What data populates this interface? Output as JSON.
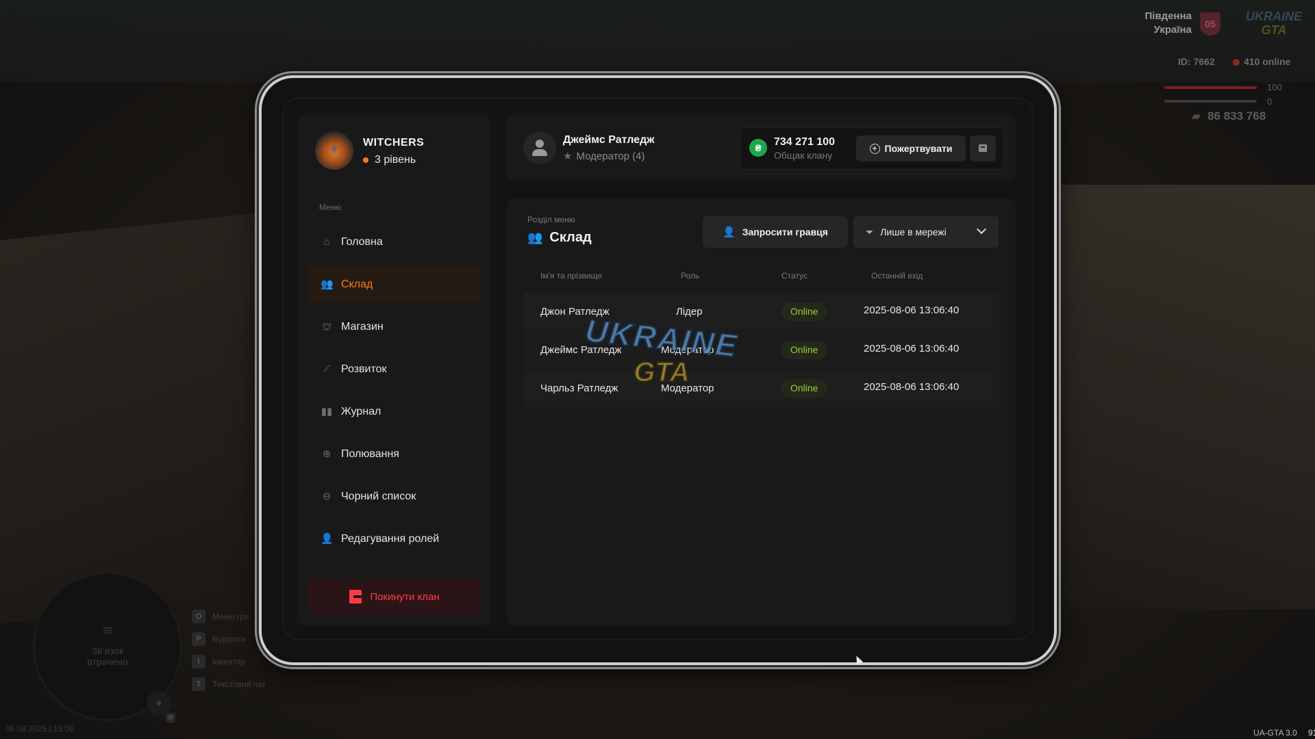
{
  "hud": {
    "region_line1": "Південна",
    "region_line2": "Україна",
    "region_badge": "05",
    "logo_top": "UKRAINE",
    "logo_bottom": "GTA",
    "player_id": "ID: 7662",
    "online": "410 online",
    "health": "100",
    "armor": "0",
    "money": "86 833 768",
    "minimap_text_line1": "Зв'язок",
    "minimap_text_line2": "втрачено",
    "mic_key": "Я",
    "hints": [
      {
        "key": "O",
        "label": "Меню гри"
      },
      {
        "key": "P",
        "label": "Відкрити"
      },
      {
        "key": "I",
        "label": "Інвентар"
      },
      {
        "key": "T",
        "label": "Текстовий чат"
      }
    ],
    "datetime": "06.08.2025 | 13:06",
    "version": "UA-GTA 3.0",
    "version_extra": "91"
  },
  "clan": {
    "name": "WITCHERS",
    "level": "3 рівень"
  },
  "menu": {
    "caption": "Меню",
    "items": [
      {
        "label": "Головна",
        "icon": "home-icon"
      },
      {
        "label": "Склад",
        "icon": "people-icon"
      },
      {
        "label": "Магазин",
        "icon": "basket-icon"
      },
      {
        "label": "Розвиток",
        "icon": "chart-icon"
      },
      {
        "label": "Журнал",
        "icon": "book-icon"
      },
      {
        "label": "Полювання",
        "icon": "crosshair-icon"
      },
      {
        "label": "Чорний список",
        "icon": "blocked-icon"
      },
      {
        "label": "Редагування ролей",
        "icon": "user-edit-icon"
      }
    ],
    "active_index": 1,
    "leave_label": "Покинути клан"
  },
  "user": {
    "name": "Джеймс Ратледж",
    "role": "Модератор (4)"
  },
  "balance": {
    "value": "734 271 100",
    "caption": "Общак клану",
    "currency_symbol": "₴",
    "donate_label": "Пожертвувати"
  },
  "section": {
    "caption": "Розділ меню",
    "title": "Склад",
    "invite_label": "Запросити гравця",
    "filter_value": "Лише в мережі"
  },
  "table": {
    "headers": [
      "Ім'я та прізвище",
      "Роль",
      "Статус",
      "Останній вхід"
    ],
    "rows": [
      {
        "name": "Джон Ратледж",
        "role": "Лідер",
        "status": "Online",
        "last": "2025-08-06 13:06:40"
      },
      {
        "name": "Джеймс Ратледж",
        "role": "Модератор",
        "status": "Online",
        "last": "2025-08-06 13:06:40"
      },
      {
        "name": "Чарльз Ратледж",
        "role": "Модератор",
        "status": "Online",
        "last": "2025-08-06 13:06:40"
      }
    ]
  },
  "watermark": {
    "top": "UKRAINE",
    "bottom": "GTA"
  },
  "colors": {
    "accent": "#ff7a1a",
    "danger": "#ff3c46",
    "online": "#9fcc3a",
    "coin": "#1fa84a"
  }
}
